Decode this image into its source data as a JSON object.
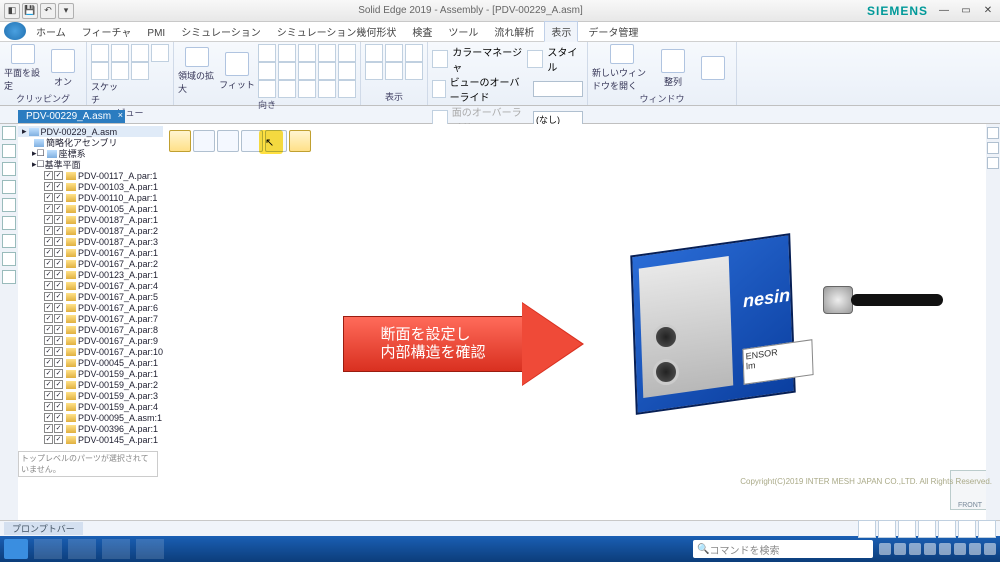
{
  "title": "Solid Edge 2019 - Assembly - [PDV-00229_A.asm]",
  "brand": "SIEMENS",
  "qat": [
    "save",
    "undo",
    "redo"
  ],
  "tabs": [
    "ホーム",
    "フィーチャ",
    "PMI",
    "シミュレーション",
    "シミュレーション幾何形状",
    "検査",
    "ツール",
    "流れ解析",
    "表示",
    "データ管理"
  ],
  "active_tab_index": 8,
  "ribbon": {
    "clipping": {
      "plane": "平面を設定",
      "on": "オン",
      "label": "クリッピング"
    },
    "view": {
      "sketch": "スケッチ",
      "label": "ビュー"
    },
    "orient": {
      "zoom_region": "領域の拡大",
      "fit": "フィット",
      "label": "向き"
    },
    "display": {
      "label": "表示",
      "color_mgr": "カラーマネージャ",
      "view_override": "ビューのオーバーライド",
      "face_override": "面のオーバーライド",
      "override_val": "(なし)"
    },
    "style": {
      "label": "スタイル",
      "btn": "スタイル"
    },
    "window": {
      "label": "ウィンドウ",
      "new_win": "新しいウィンドウを開く",
      "arrange": "整列"
    }
  },
  "doc_tab": "PDV-00229_A.asm",
  "tree": {
    "root": "PDV-00229_A.asm",
    "sub1": "簡略化アセンブリ",
    "coords": "座標系",
    "refplane": "基準平面",
    "items": [
      "PDV-00117_A.par:1",
      "PDV-00103_A.par:1",
      "PDV-00110_A.par:1",
      "PDV-00105_A.par:1",
      "PDV-00187_A.par:1",
      "PDV-00187_A.par:2",
      "PDV-00187_A.par:3",
      "PDV-00167_A.par:1",
      "PDV-00167_A.par:2",
      "PDV-00123_A.par:1",
      "PDV-00167_A.par:4",
      "PDV-00167_A.par:5",
      "PDV-00167_A.par:6",
      "PDV-00167_A.par:7",
      "PDV-00167_A.par:8",
      "PDV-00167_A.par:9",
      "PDV-00167_A.par:10",
      "PDV-00045_A.par:1",
      "PDV-00159_A.par:1",
      "PDV-00159_A.par:2",
      "PDV-00159_A.par:3",
      "PDV-00159_A.par:4",
      "PDV-00095_A.asm:1",
      "PDV-00396_A.par:1",
      "PDV-00145_A.par:1"
    ],
    "footer": "トップレベルのパーツが選択されていません。"
  },
  "callout": {
    "line1": "断面を設定し",
    "line2": "内部構造を確認"
  },
  "part": {
    "brand": "nesin",
    "label1": "ENSOR",
    "label2": "lm"
  },
  "viewcube": "FRONT",
  "copyright": "Copyright(C)2019 INTER MESH JAPAN CO.,LTD. All Rights Reserved.",
  "statusbar": {
    "prompt": "プロンプトバー"
  },
  "taskbar": {
    "search_placeholder": "コマンドを検索"
  }
}
